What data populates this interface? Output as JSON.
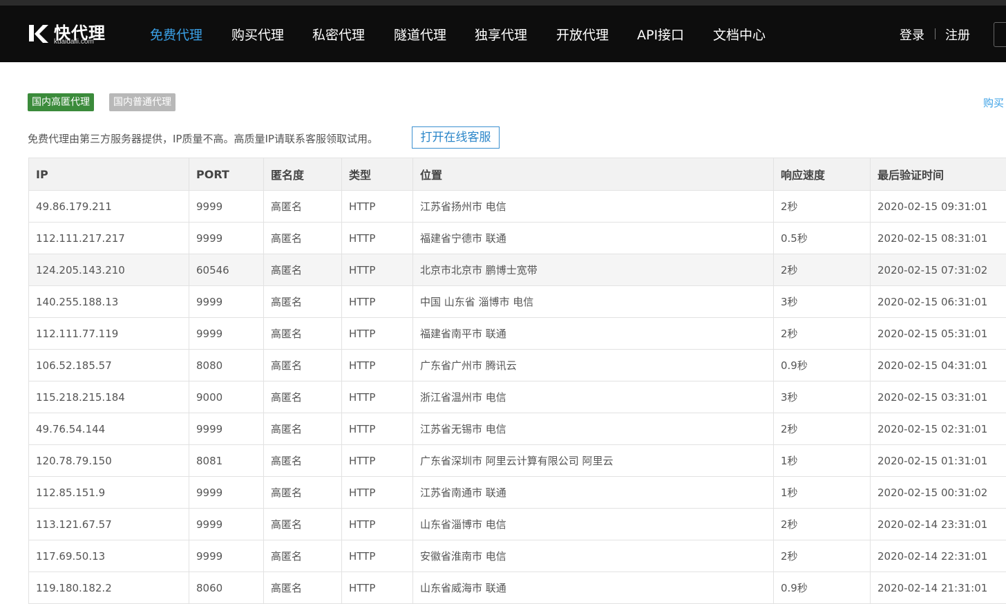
{
  "logo": {
    "main": "快代理",
    "sub": "kuaidaili.com"
  },
  "nav": {
    "items": [
      {
        "label": "免费代理",
        "active": true
      },
      {
        "label": "购买代理",
        "active": false
      },
      {
        "label": "私密代理",
        "active": false
      },
      {
        "label": "隧道代理",
        "active": false
      },
      {
        "label": "独享代理",
        "active": false
      },
      {
        "label": "开放代理",
        "active": false
      },
      {
        "label": "API接口",
        "active": false
      },
      {
        "label": "文档中心",
        "active": false
      }
    ],
    "login": "登录",
    "register": "注册"
  },
  "colors": {
    "accent": "#3aa0e6",
    "tag_green": "#3b8b3b",
    "tag_gray": "#b8b8b8",
    "navbar": "#0d0d0d"
  },
  "tags": {
    "elite": "国内高匿代理",
    "normal": "国内普通代理"
  },
  "buy_link": "购买",
  "notice": "免费代理由第三方服务器提供，IP质量不高。高质量IP请联系客服领取试用。",
  "service_button": "打开在线客服",
  "table": {
    "headers": [
      "IP",
      "PORT",
      "匿名度",
      "类型",
      "位置",
      "响应速度",
      "最后验证时间"
    ],
    "rows": [
      [
        "49.86.179.211",
        "9999",
        "高匿名",
        "HTTP",
        "江苏省扬州市 电信",
        "2秒",
        "2020-02-15 09:31:01"
      ],
      [
        "112.111.217.217",
        "9999",
        "高匿名",
        "HTTP",
        "福建省宁德市 联通",
        "0.5秒",
        "2020-02-15 08:31:01"
      ],
      [
        "124.205.143.210",
        "60546",
        "高匿名",
        "HTTP",
        "北京市北京市 鹏博士宽带",
        "2秒",
        "2020-02-15 07:31:02"
      ],
      [
        "140.255.188.13",
        "9999",
        "高匿名",
        "HTTP",
        "中国 山东省 淄博市 电信",
        "3秒",
        "2020-02-15 06:31:01"
      ],
      [
        "112.111.77.119",
        "9999",
        "高匿名",
        "HTTP",
        "福建省南平市 联通",
        "2秒",
        "2020-02-15 05:31:01"
      ],
      [
        "106.52.185.57",
        "8080",
        "高匿名",
        "HTTP",
        "广东省广州市 腾讯云",
        "0.9秒",
        "2020-02-15 04:31:01"
      ],
      [
        "115.218.215.184",
        "9000",
        "高匿名",
        "HTTP",
        "浙江省温州市 电信",
        "3秒",
        "2020-02-15 03:31:01"
      ],
      [
        "49.76.54.144",
        "9999",
        "高匿名",
        "HTTP",
        "江苏省无锡市 电信",
        "2秒",
        "2020-02-15 02:31:01"
      ],
      [
        "120.78.79.150",
        "8081",
        "高匿名",
        "HTTP",
        "广东省深圳市 阿里云计算有限公司 阿里云",
        "1秒",
        "2020-02-15 01:31:01"
      ],
      [
        "112.85.151.9",
        "9999",
        "高匿名",
        "HTTP",
        "江苏省南通市 联通",
        "1秒",
        "2020-02-15 00:31:02"
      ],
      [
        "113.121.67.57",
        "9999",
        "高匿名",
        "HTTP",
        "山东省淄博市 电信",
        "2秒",
        "2020-02-14 23:31:01"
      ],
      [
        "117.69.50.13",
        "9999",
        "高匿名",
        "HTTP",
        "安徽省淮南市 电信",
        "2秒",
        "2020-02-14 22:31:01"
      ],
      [
        "119.180.182.2",
        "8060",
        "高匿名",
        "HTTP",
        "山东省威海市 联通",
        "0.9秒",
        "2020-02-14 21:31:01"
      ]
    ]
  }
}
